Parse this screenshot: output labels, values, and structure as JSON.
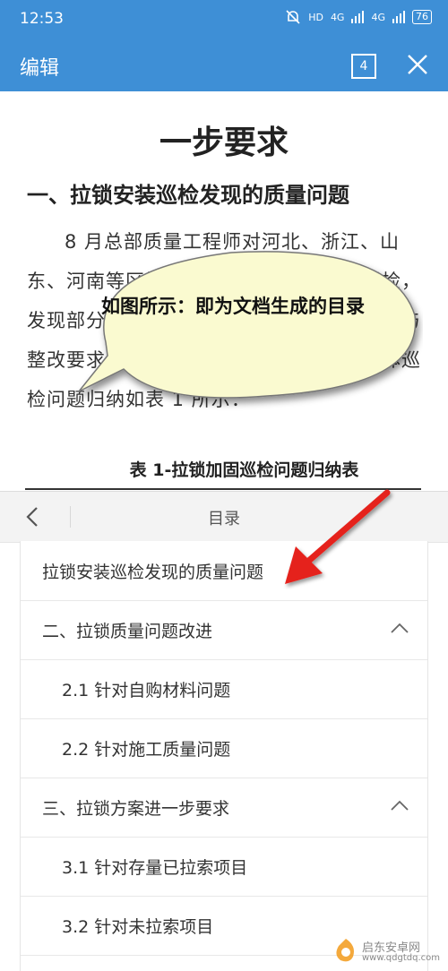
{
  "status": {
    "time": "12:53",
    "net1": "4G",
    "net2": "4G",
    "hd": "HD",
    "battery": "76"
  },
  "appbar": {
    "title": "编辑",
    "page_count": "4"
  },
  "document": {
    "title_line2": "一步要求",
    "heading": "一、拉锁安装巡检发现的质量问题",
    "paragraph": "8 月总部质量工程师对河北、浙江、山东、河南等区域开展拉锁安装质量专题巡检，发现部分项目仍存在质量问题，现现场问题与整改要求汇总如下，并提出改进措施，具体巡检问题归纳如表 1 所示：",
    "caption": "表 1-拉锁加固巡检问题归纳表"
  },
  "annotation": {
    "bubble_text": "如图所示：即为文档生成的目录",
    "arrow_color": "#e5221c",
    "bubble_color": "#fafad0"
  },
  "toc": {
    "title": "目录",
    "items": [
      {
        "label": "拉锁安装巡检发现的质量问题",
        "expandable": false
      },
      {
        "label": "二、拉锁质量问题改进",
        "expandable": true
      },
      {
        "label": "2.1 针对自购材料问题",
        "expandable": false
      },
      {
        "label": "2.2 针对施工质量问题",
        "expandable": false
      },
      {
        "label": "三、拉锁方案进一步要求",
        "expandable": true
      },
      {
        "label": "3.1 针对存量已拉索项目",
        "expandable": false
      },
      {
        "label": "3.2 针对未拉索项目",
        "expandable": false
      }
    ]
  },
  "watermark": {
    "name": "启东安卓网",
    "url": "www.qdgtdq.com"
  }
}
